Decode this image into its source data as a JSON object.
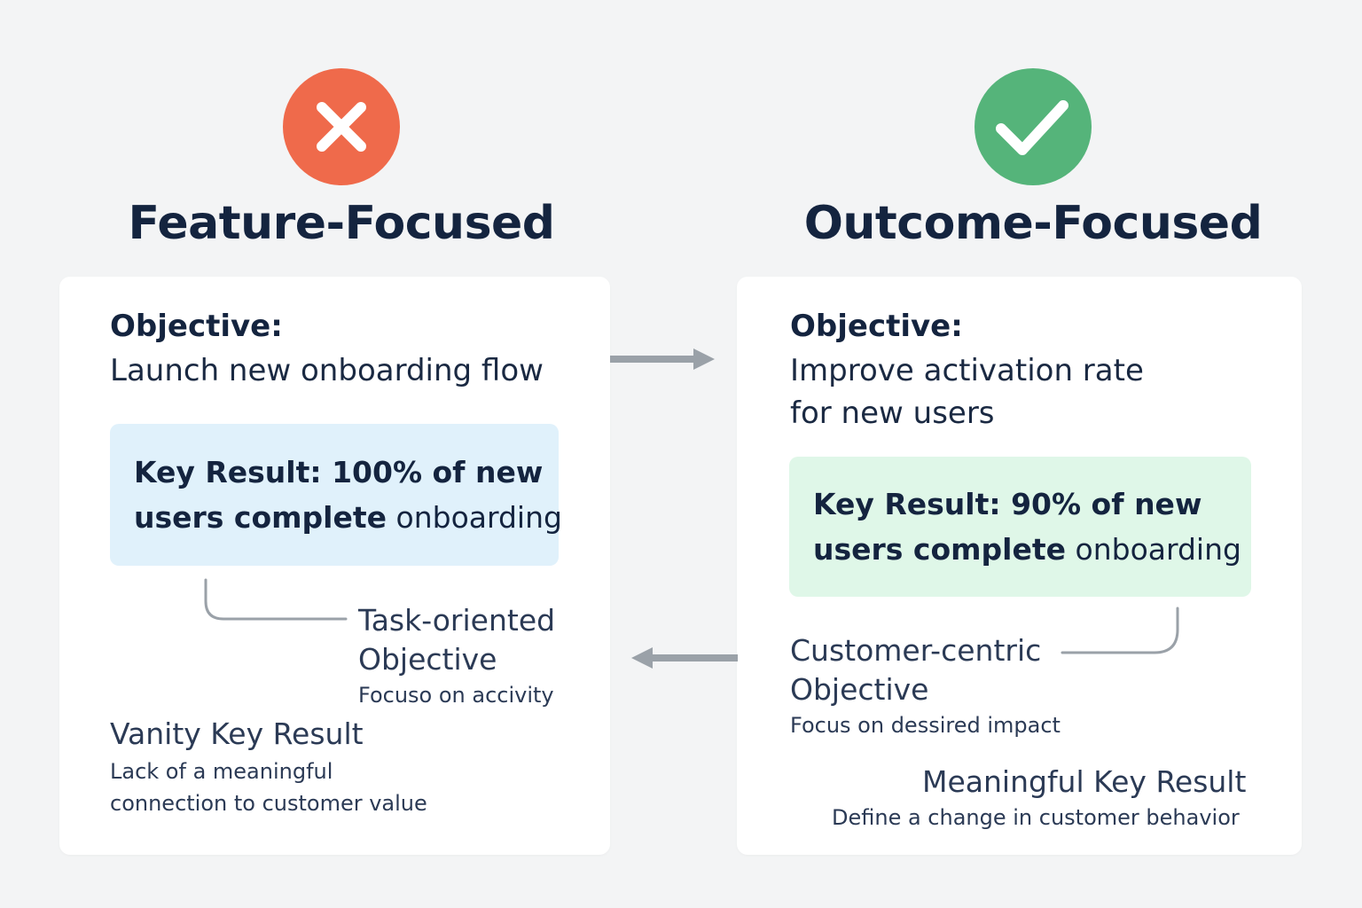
{
  "colors": {
    "background": "#f3f4f5",
    "bad": "#ef6a4b",
    "good": "#55b47a",
    "title": "#14243f",
    "kr_left_bg": "#e0f1fb",
    "kr_right_bg": "#dff7e8",
    "connector": "#9aa1a8"
  },
  "left": {
    "icon": "x-icon",
    "title": "Feature-Focused",
    "objective_label": "Objective:",
    "objective_text": "Launch new onboarding flow",
    "kr_line1": "Key Result: 100% of new",
    "kr_line2_bold": "users complete",
    "kr_line2_rest": "onboarding",
    "note_title": "Task-oriented\nObjective",
    "note_sub": "Focuso on accivity",
    "vanity_title": "Vanity Key Result",
    "vanity_sub": "Lack of a meaningful\nconnection to customer value"
  },
  "right": {
    "icon": "check-icon",
    "title": "Outcome-Focused",
    "objective_label": "Objective:",
    "objective_text": "Improve activation rate\nfor new users",
    "kr_line1": "Key Result: 90% of new",
    "kr_line2_bold": "users complete",
    "kr_line2_rest": "onboarding",
    "note_title": "Customer-centric\nObjective",
    "note_sub": "Focus on dessired impact",
    "meaningful_title": "Meaningful Key Result",
    "meaningful_sub": "Define a change in customer behavior"
  }
}
